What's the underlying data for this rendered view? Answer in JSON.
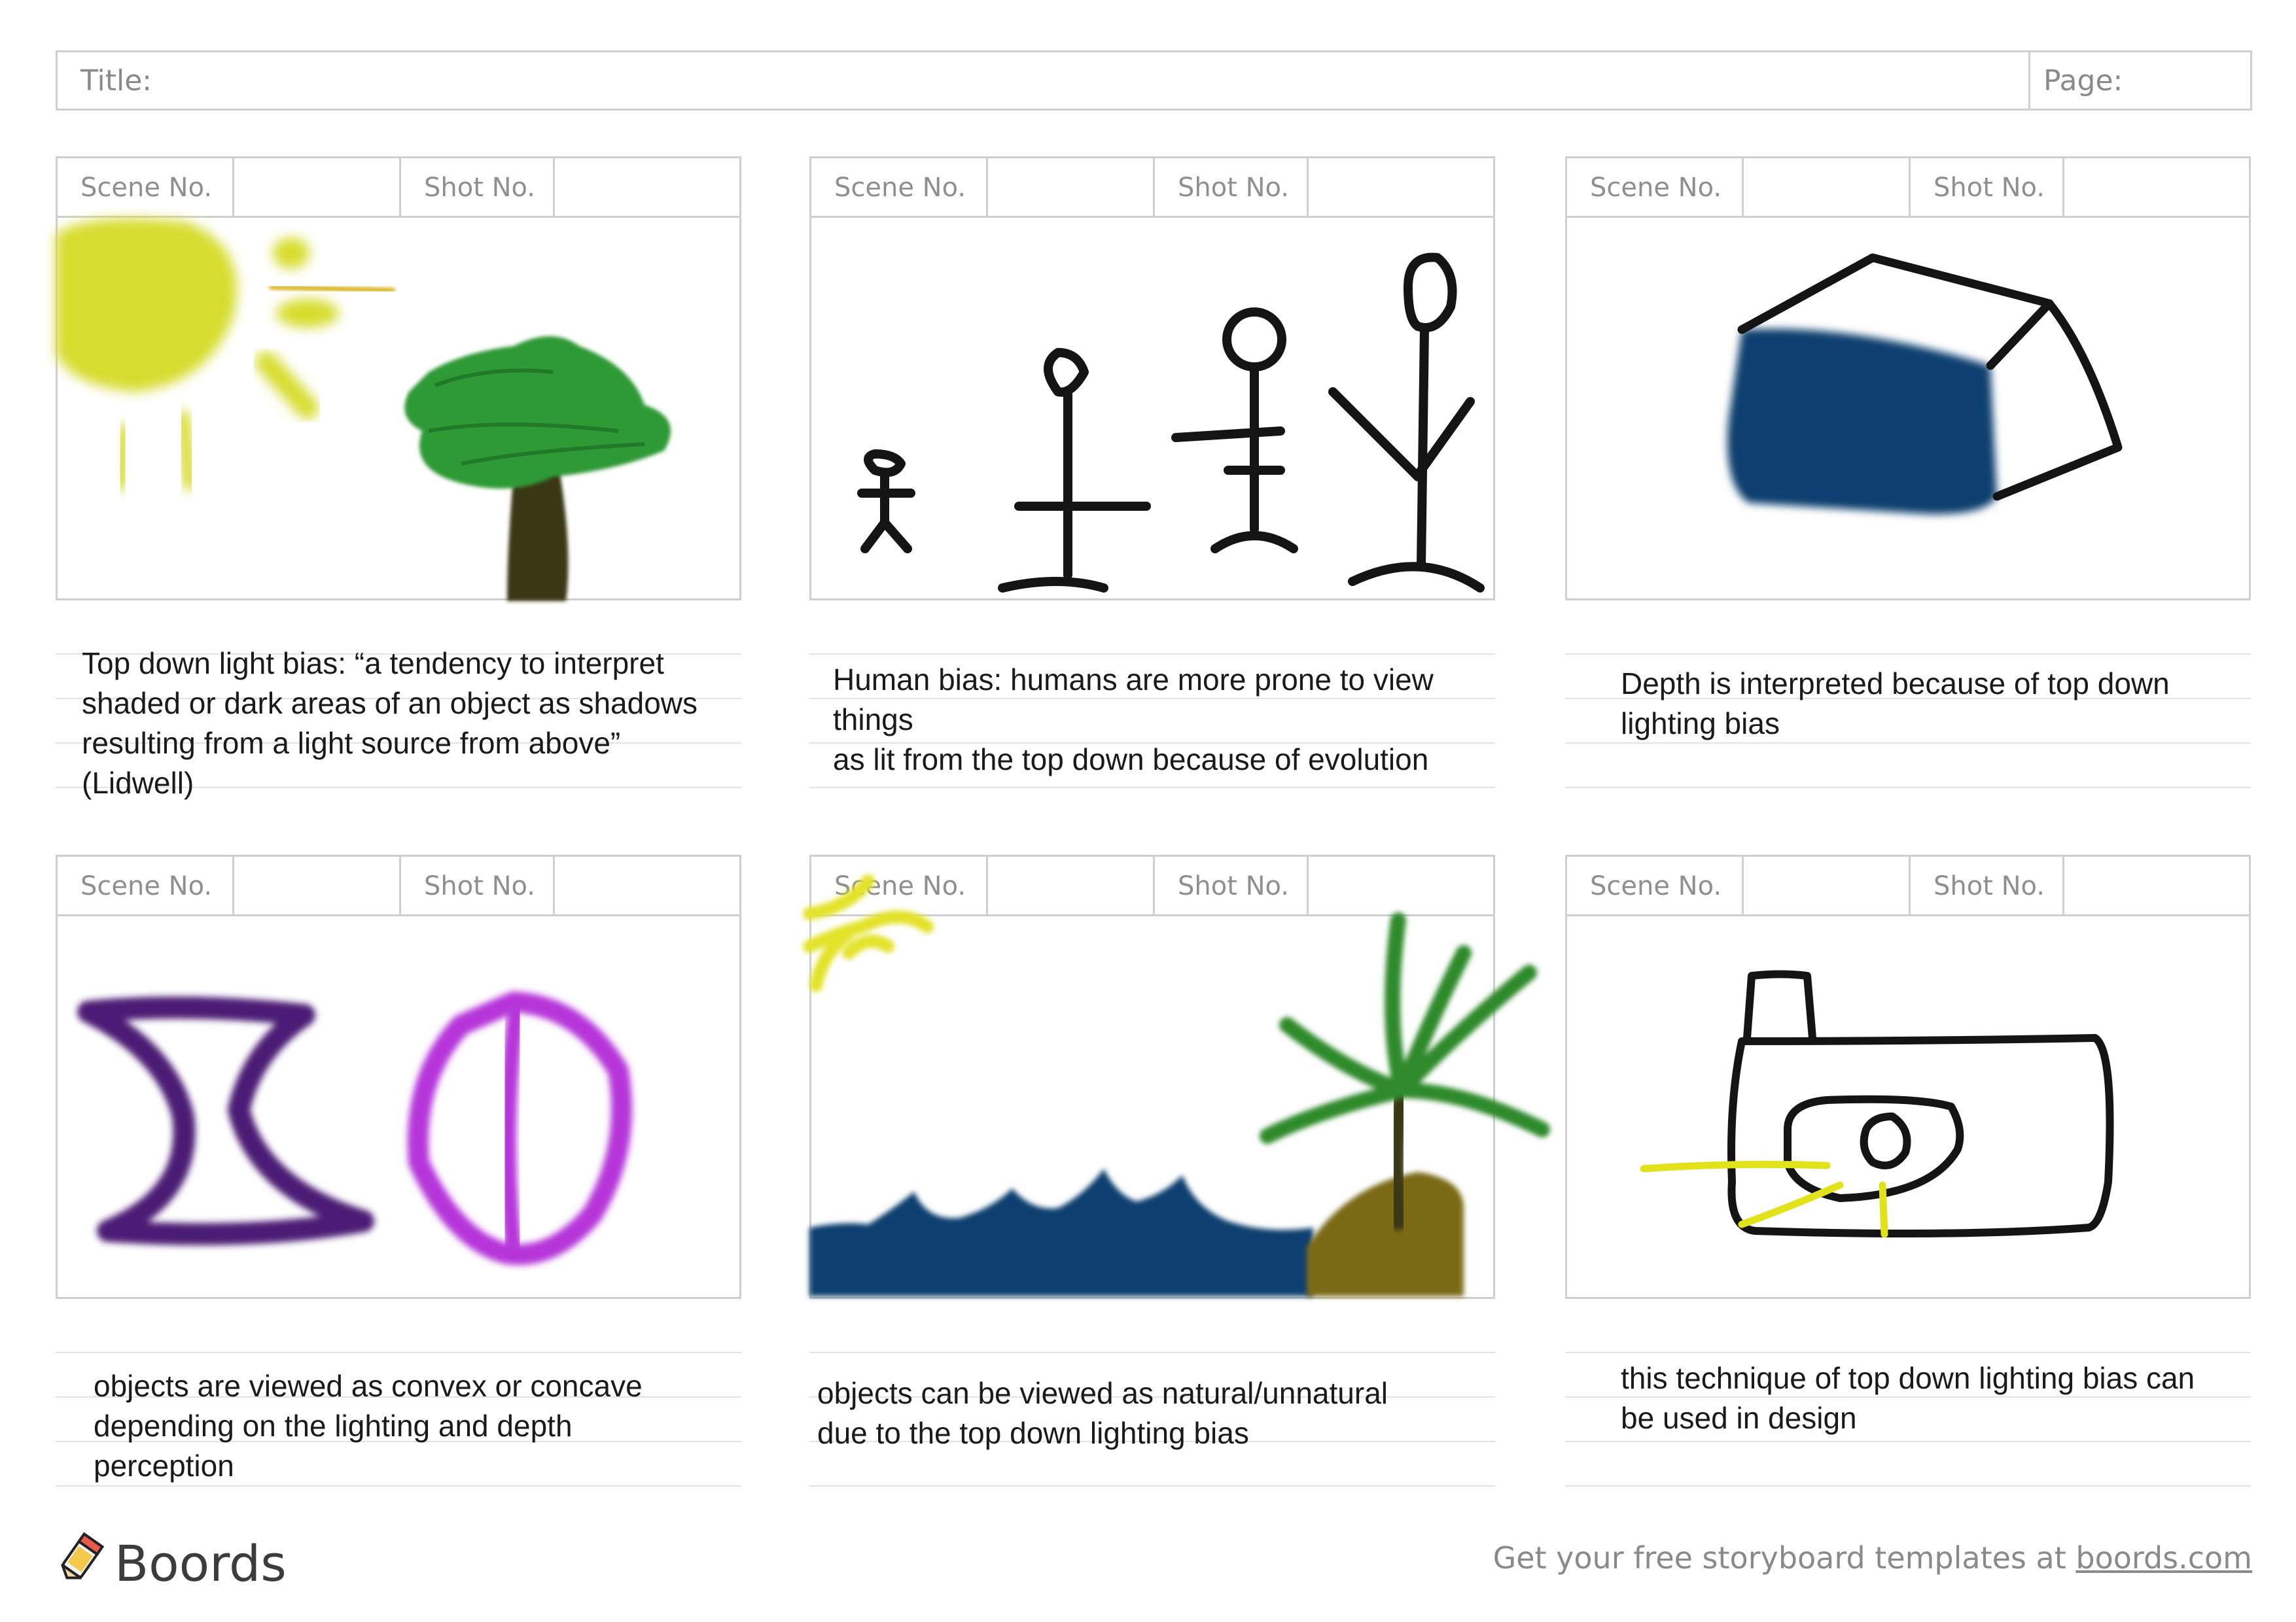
{
  "header": {
    "title_label": "Title:",
    "page_label": "Page:"
  },
  "panels": [
    {
      "scene_label": "Scene No.",
      "shot_label": "Shot No.",
      "caption": "Top down light bias: “a tendency to interpret\nshaded or dark areas of an object as shadows\nresulting from a light source from above”\n(Lidwell)",
      "icons": [
        "sun-icon",
        "tree-icon"
      ]
    },
    {
      "scene_label": "Scene No.",
      "shot_label": "Shot No.",
      "caption": "Human bias: humans are more prone to view things\nas lit from the top down because of evolution",
      "icons": [
        "stick-figures-icon"
      ]
    },
    {
      "scene_label": "Scene No.",
      "shot_label": "Shot No.",
      "caption": "Depth is interpreted because of top down\nlighting bias",
      "icons": [
        "cube-icon"
      ]
    },
    {
      "scene_label": "Scene No.",
      "shot_label": "Shot No.",
      "caption": "objects are viewed as convex or concave\ndepending on the lighting and depth\nperception",
      "icons": [
        "hourglass-icon",
        "split-circle-icon"
      ]
    },
    {
      "scene_label": "Scene No.",
      "shot_label": "Shot No.",
      "caption": "objects can be viewed as natural/unnatural\ndue to the top down lighting bias",
      "icons": [
        "sun-icon",
        "waves-icon",
        "palm-tree-icon"
      ]
    },
    {
      "scene_label": "Scene No.",
      "shot_label": "Shot No.",
      "caption": "this technique of top down lighting bias can\nbe used in design",
      "icons": [
        "camera-icon"
      ]
    }
  ],
  "footer": {
    "brand": "Boords",
    "promo_text": "Get your free storyboard templates at ",
    "promo_link": "boords.com"
  },
  "colors": {
    "sun": "#d7dd2f",
    "tree_green": "#2e9a34",
    "trunk": "#3b3717",
    "navy": "#0f3f70",
    "purple_dark": "#4b1c74",
    "magenta": "#b534d9",
    "sand": "#7a6a16",
    "frame_border": "#cfcfcf"
  }
}
